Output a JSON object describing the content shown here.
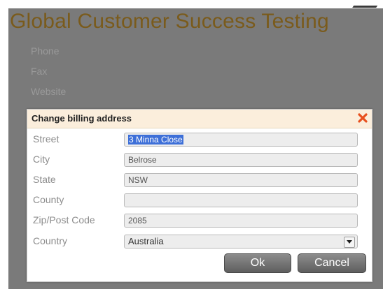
{
  "page": {
    "title": "Global Customer Success Testing",
    "background_fields": [
      "Phone",
      "Fax",
      "Website"
    ]
  },
  "dialog": {
    "title": "Change billing address",
    "close_icon": "close-icon",
    "fields": {
      "street": {
        "label": "Street",
        "value": "3 Minna Close"
      },
      "city": {
        "label": "City",
        "value": "Belrose"
      },
      "state": {
        "label": "State",
        "value": "NSW"
      },
      "county": {
        "label": "County",
        "value": ""
      },
      "zip": {
        "label": "Zip/Post Code",
        "value": "2085"
      },
      "country": {
        "label": "Country",
        "value": "Australia"
      }
    },
    "buttons": {
      "ok": "Ok",
      "cancel": "Cancel"
    }
  },
  "colors": {
    "title": "#7a5b1c",
    "backdrop": "#7a7a7a",
    "dialog_header": "#fbeedc",
    "close_icon": "#e8501e",
    "selection": "#3d6fd8"
  }
}
